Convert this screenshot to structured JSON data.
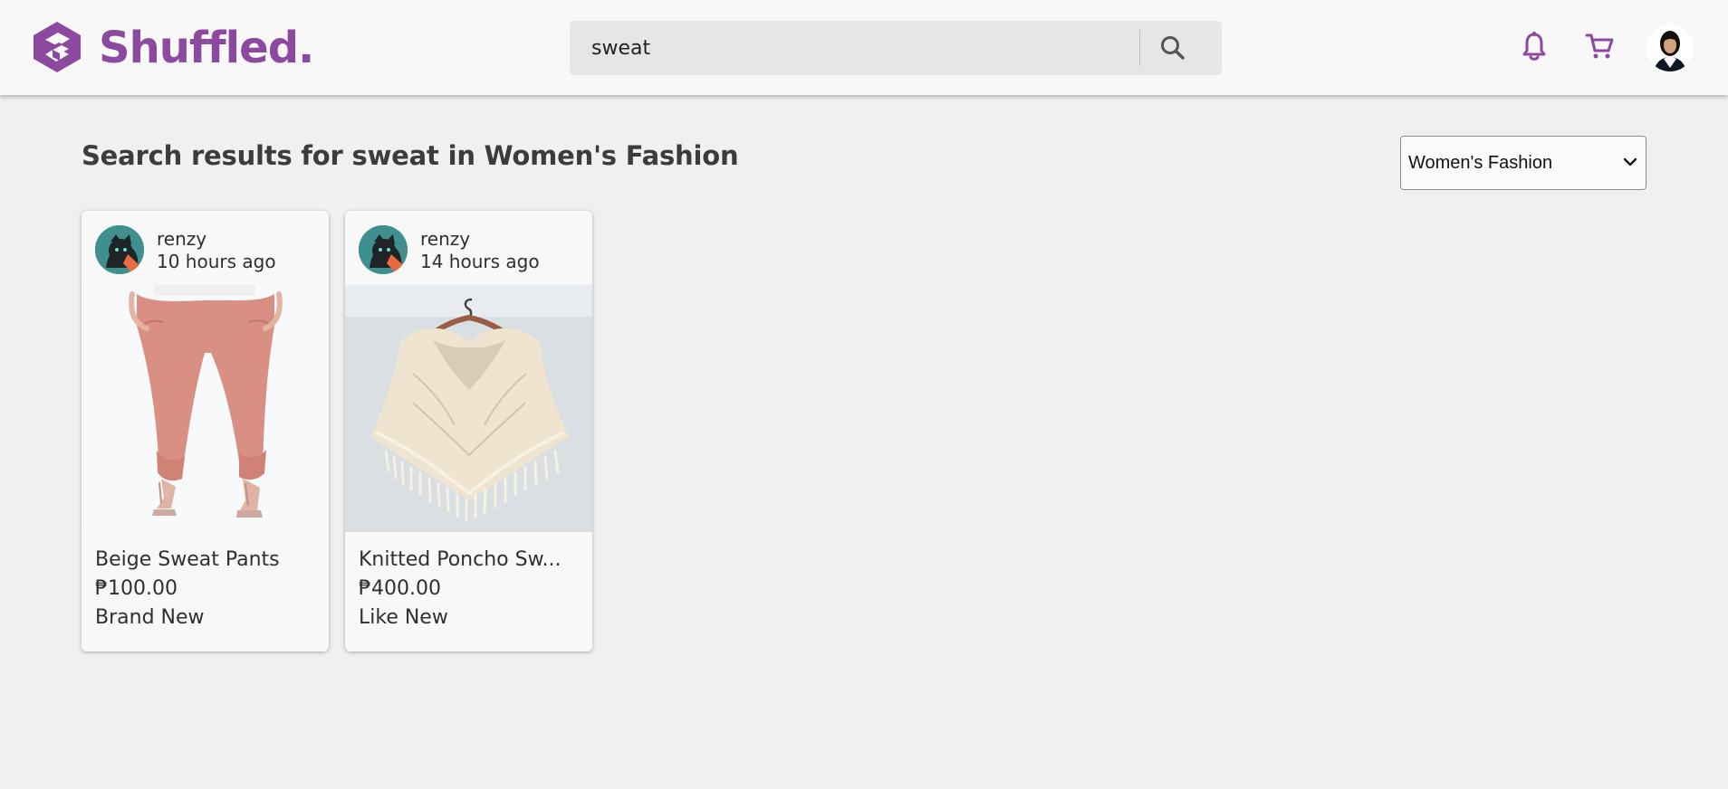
{
  "brand": {
    "name": "Shuffled.",
    "logo_icon": "shuffled-logo-icon",
    "color": "#8b4a9f"
  },
  "search": {
    "value": "sweat",
    "placeholder": "",
    "icon": "search-icon"
  },
  "header": {
    "notification_icon": "bell-icon",
    "cart_icon": "cart-icon",
    "profile_icon": "user-avatar"
  },
  "results": {
    "heading": "Search results for sweat in Women's Fashion"
  },
  "filter": {
    "category": "Women's Fashion"
  },
  "products": [
    {
      "seller": "renzy",
      "time": "10 hours ago",
      "title": "Beige Sweat Pants",
      "price": "₱100.00",
      "condition": "Brand New",
      "image_icon": "pink-sweat-pants-image"
    },
    {
      "seller": "renzy",
      "time": "14 hours ago",
      "title": "Knitted Poncho Sw...",
      "price": "₱400.00",
      "condition": "Like New",
      "image_icon": "knitted-poncho-image"
    }
  ],
  "colors": {
    "accent": "#8b4a9f",
    "background": "#f1eff0",
    "surface": "#f8f8f8",
    "search_bg": "#e6e6e6"
  }
}
